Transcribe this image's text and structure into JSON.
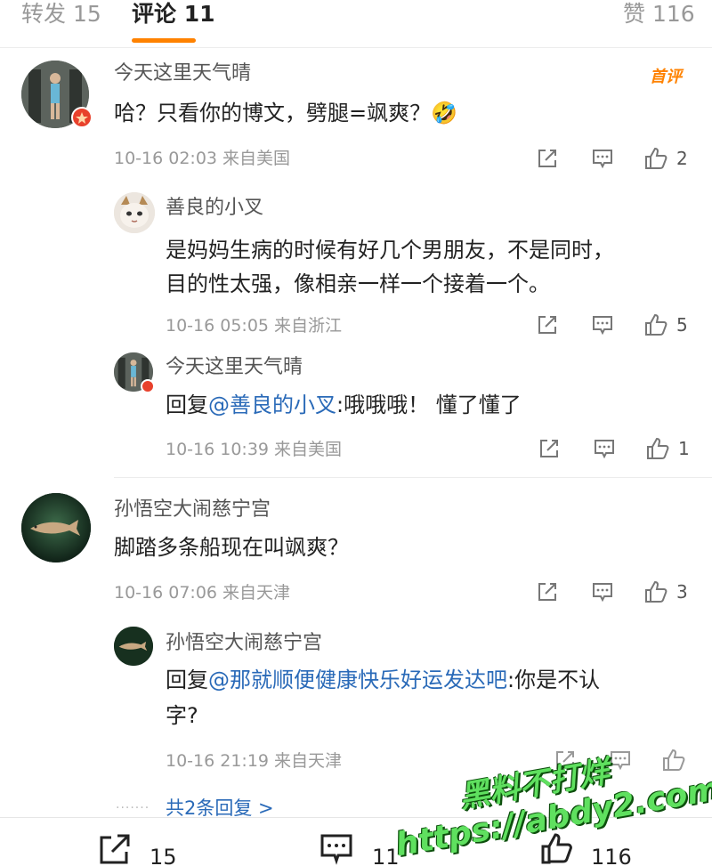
{
  "tabs": {
    "repost_label": "转发",
    "repost_count": "15",
    "comment_label": "评论",
    "comment_count": "11",
    "like_label": "赞",
    "like_count": "116"
  },
  "comments": [
    {
      "name": "今天这里天气晴",
      "text": "哈？只看你的博文，劈腿=飒爽？🤣",
      "meta": "10-16 02:03 来自美国",
      "tag": "首评",
      "likes": "2"
    },
    {
      "name": "善良的小叉",
      "text_line1": "是妈妈生病的时候有好几个男朋友，不是同时，",
      "text_line2": "目的性太强，像相亲一样一个接着一个。",
      "meta": "10-16 05:05 来自浙江",
      "likes": "5"
    },
    {
      "name": "今天这里天气晴",
      "reply_prefix": "回复",
      "mention": "@善良的小叉",
      "text": ":哦哦哦！ 懂了懂了",
      "meta": "10-16 10:39 来自美国",
      "likes": "1"
    },
    {
      "name": "孙悟空大闹慈宁宫",
      "text": "脚踏多条船现在叫飒爽？",
      "meta": "10-16 07:06 来自天津",
      "likes": "3"
    },
    {
      "name": "孙悟空大闹慈宁宫",
      "reply_prefix": "回复",
      "mention": "@那就顺便健康快乐好运发达吧",
      "text_line1": ":你是不认",
      "text_line2": "字?",
      "meta": "10-16 21:19 来自天津",
      "likes": ""
    }
  ],
  "more_replies": "共2条回复 >",
  "bottom_bar": {
    "repost": "15",
    "comment": "11",
    "like": "116"
  },
  "watermark": {
    "line1": "黑料不打烊",
    "line2": "https://abdy2.com"
  },
  "colors": {
    "accent": "#ff8200",
    "link": "#2a6ab8",
    "badge": "#e8412c"
  }
}
